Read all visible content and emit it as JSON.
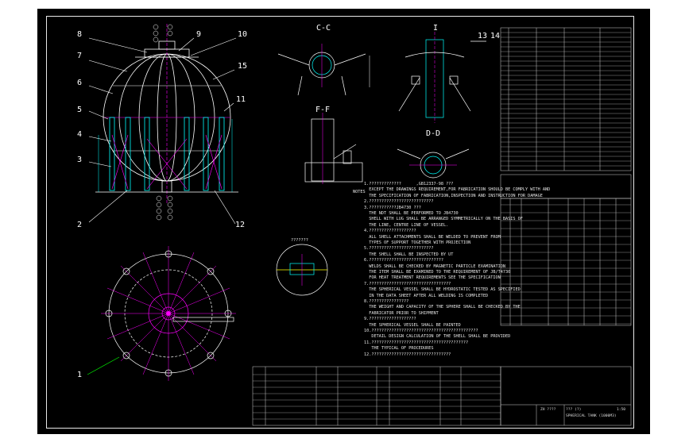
{
  "colors": {
    "background": "#000000",
    "outline": "#ffffff",
    "centerline": "#ff00ff",
    "dimension": "#00ffff",
    "leader": "#ffffff",
    "accent_green": "#00ff00",
    "accent_red": "#ff3030",
    "accent_yellow": "#ffff00"
  },
  "part_labels": [
    "8",
    "9",
    "10",
    "7",
    "15",
    "6",
    "5",
    "11",
    "4",
    "3",
    "2",
    "12",
    "1",
    "13",
    "14"
  ],
  "sections": {
    "ce": "C-C",
    "i": "I",
    "ff": "F-F",
    "dd": "D-D"
  },
  "notes_heading": "NOTES",
  "notes": [
    "1.?????????????      ,GB12337-98 ???",
    "  EXCEPT THE DRAWINGS REQUIREMENT,FOR FABRICATION SHOULD BE COMPLY WITH AND",
    "  THE SPECIFICATION OF FABRICATION,INSPECTION AND INSTRUCTION FOR DAMAGE",
    "2.??????????????????????????",
    "3.???????????JB4730 ???",
    "  THE NDT SHALL BE PERFORMED TO JB4730",
    "  SHELL WITH LUG SHALL BE ARRANGED SYMMETRICALLY ON THE BASIS OF",
    "  THE LINE, CENTRE LINE OF VESSEL.",
    "4.???????????????????",
    "  ALL SHELL ATTACHMENTS SHALL BE WELDED TO PREVENT FROM",
    "  TYPES OF SUPPORT TOGETHER WITH PROJECTION",
    "5.??????????????????????????",
    "  THE SHELL SHALL BE INSPECTED BY UT ",
    "6.??????????????????????????????",
    "  WELDS SHALL BE CHECKED BY MAGNETIC PARTICLE EXAMINATION",
    "  THE ITEM SHALL BE EXAMINED TO THE REQUIREMENT OF JB/T4730",
    "  FOR HEAT TREATMENT REQUIREMENTS SEE THE SPECIFICATION",
    "7.?????????????????????????????????",
    "  THE SPHERICAL VESSEL SHALL BE HYDROSTATIC TESTED AS SPECIFIED",
    "  IN THE DATA SHEET AFTER ALL WELDING IS COMPLETED",
    "8.????????????????",
    "  THE WEIGHT AND CAPACITY OF THE SPHERE SHALL BE CHECKED BY THE",
    "  FABRICATOR PRIOR TO SHIPMENT",
    "9.???????????????????",
    "  THE SPHERICAL VESSEL SHALL BE PAINTED",
    "10.???????????????????????????????????????????",
    "   DETAIL DESIGN CALCULATION OF THE SHELL SHALL BE PROVIDED",
    "11.???????????????????????????????????????",
    "   THE TYPICAL OF PROCEDURES",
    "12.????????????????????????????????"
  ],
  "weld_detail_label": "???????",
  "title_block": {
    "header": "ZH  ????",
    "drawing_title": "???  (?)",
    "subtitle": "SPHERICAL TANK  (1000M3)",
    "scale_label": "1:50"
  }
}
